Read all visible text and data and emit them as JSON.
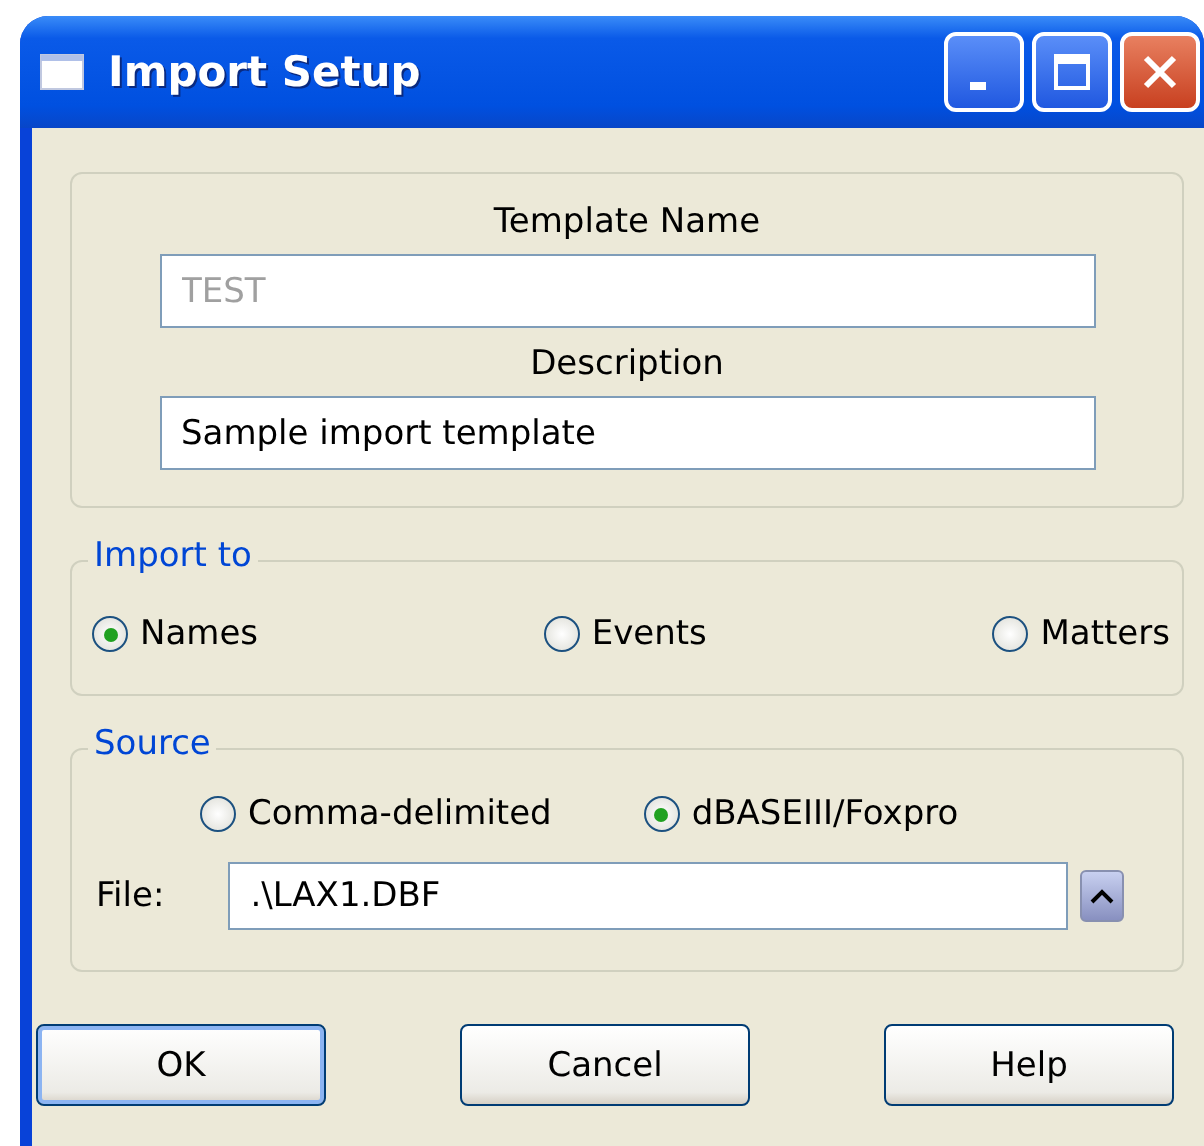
{
  "window": {
    "title": "Import Setup"
  },
  "template": {
    "name_label": "Template Name",
    "name_value": "TEST",
    "name_disabled": true,
    "description_label": "Description",
    "description_value": "Sample import template"
  },
  "import_to": {
    "legend": "Import to",
    "options": [
      {
        "label": "Names",
        "selected": true
      },
      {
        "label": "Events",
        "selected": false
      },
      {
        "label": "Matters",
        "selected": false
      }
    ]
  },
  "source": {
    "legend": "Source",
    "options": [
      {
        "label": "Comma-delimited",
        "selected": false
      },
      {
        "label": "dBASEIII/Foxpro",
        "selected": true
      }
    ],
    "file_label": "File:",
    "file_value": ".\\LAX1.DBF"
  },
  "buttons": [
    {
      "label": "OK",
      "default": true
    },
    {
      "label": "Cancel",
      "default": false
    },
    {
      "label": "Help",
      "default": false
    }
  ]
}
